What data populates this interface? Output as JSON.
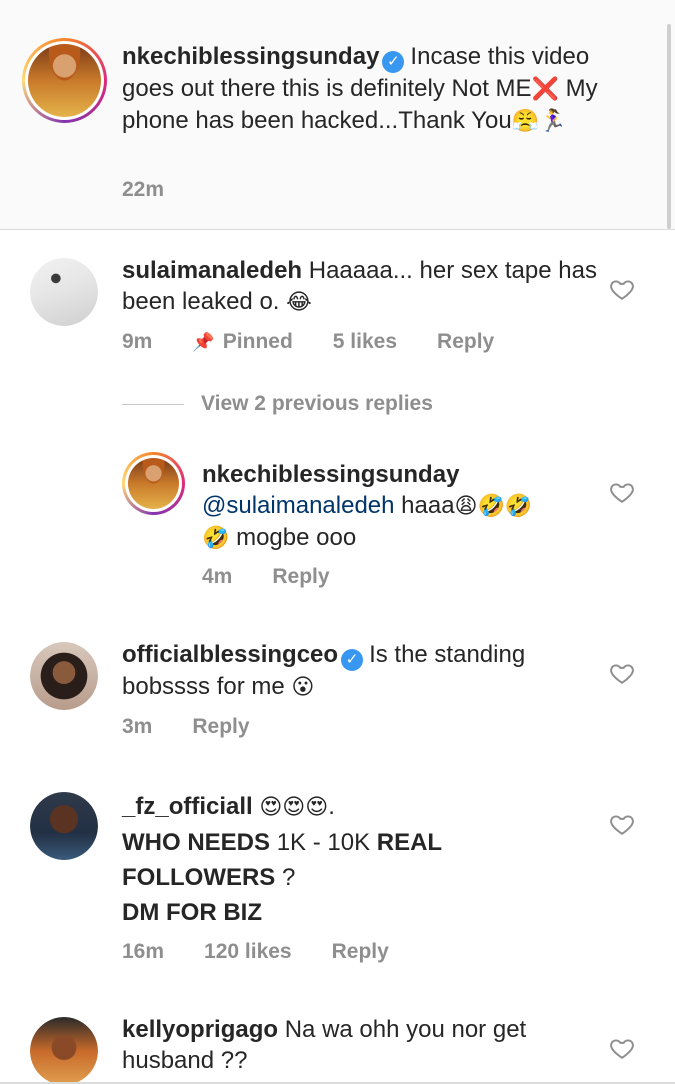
{
  "caption": {
    "username": "nkechiblessingsunday",
    "text_1": "Incase this video goes out there this is definitely Not ME",
    "emoji_x": "❌",
    "text_2": " My phone has been hacked...Thank You",
    "emoji_end": "😤🏃‍♀️",
    "time": "22m"
  },
  "comments": [
    {
      "username": "sulaimanaledeh",
      "text": "Haaaaa... her sex tape has been leaked o.",
      "emoji": "😂",
      "time": "9m",
      "pinned_label": "Pinned",
      "likes": "5 likes",
      "reply_label": "Reply",
      "view_replies": "View 2 previous replies",
      "reply": {
        "username": "nkechiblessingsunday",
        "mention": "@sulaimanaledeh",
        "text_1": "haaa",
        "emoji_1": "😩🤣🤣",
        "emoji_2": "🤣",
        "text_2": "mogbe ooo",
        "time": "4m",
        "reply_label": "Reply"
      }
    },
    {
      "username": "officialblessingceo",
      "text": "Is the standing bobssss for me",
      "emoji": "😮",
      "time": "3m",
      "reply_label": "Reply"
    },
    {
      "username": "_fz_officiall",
      "emoji_1": "😍😍😍",
      "text_1": ".",
      "line_2a": "WHO NEEDS ",
      "line_2b": "1K - 10K",
      "line_2c": " REAL",
      "line_3a": "FOLLOWERS",
      "line_3b": " ?",
      "line_4": "DM FOR BIZ",
      "time": "16m",
      "likes": "120 likes",
      "reply_label": "Reply"
    },
    {
      "username": "kellyoprigago",
      "text": "Na wa ohh you nor get husband ??"
    }
  ],
  "icons": {
    "heart": "heart-outline-icon",
    "pin": "pin-icon",
    "verified": "verified-badge-icon"
  },
  "colors": {
    "verified": "#3897f0",
    "secondary_text": "#8e8e8e",
    "mention": "#003569"
  }
}
